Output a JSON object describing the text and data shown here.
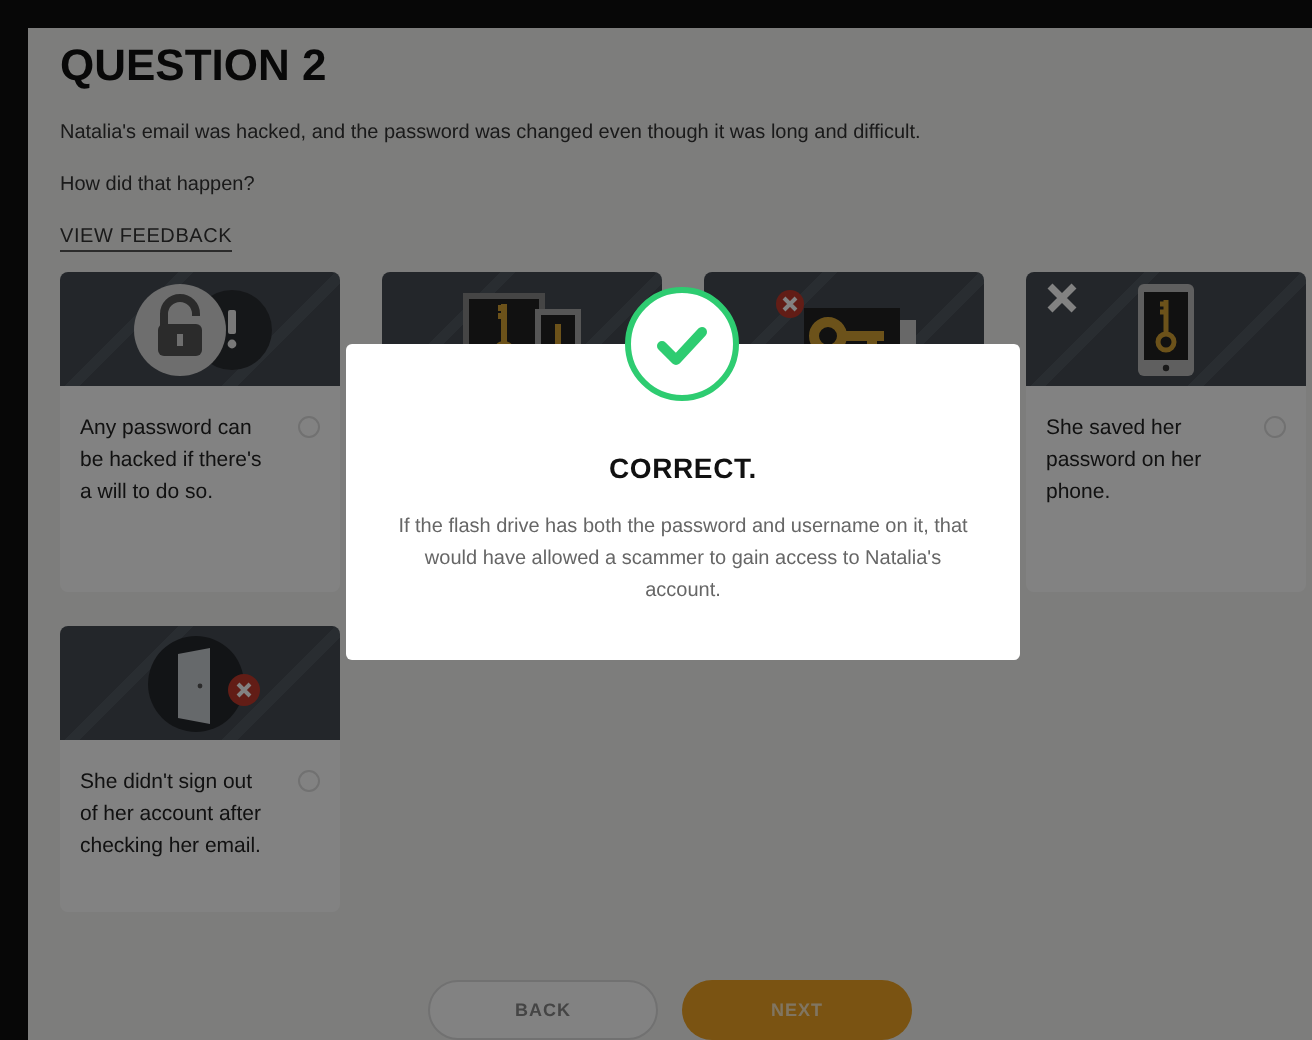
{
  "question": {
    "title": "QUESTION 2",
    "prompt": "Natalia's email was hacked, and the password was changed even though it was long and difficult.",
    "ask": "How did that happen?",
    "feedback_link": "VIEW FEEDBACK"
  },
  "options": [
    {
      "kind": "lock",
      "text": "Any password can be hacked if there's a will to do so.",
      "selected": false,
      "marked_wrong": false
    },
    {
      "kind": "frames"
    },
    {
      "kind": "flashdrive"
    },
    {
      "kind": "phone",
      "text": "She saved her password on her phone.",
      "selected": false,
      "marked_wrong": true
    },
    {
      "kind": "door",
      "text": "She didn't sign out of her account after checking her email.",
      "selected": false,
      "marked_wrong": false
    }
  ],
  "buttons": {
    "back": "BACK",
    "next": "NEXT"
  },
  "modal": {
    "correct": true,
    "title": "CORRECT.",
    "message": "If the flash drive has both the password and username on it, that would have allowed a scammer to gain access to Natalia's account."
  }
}
